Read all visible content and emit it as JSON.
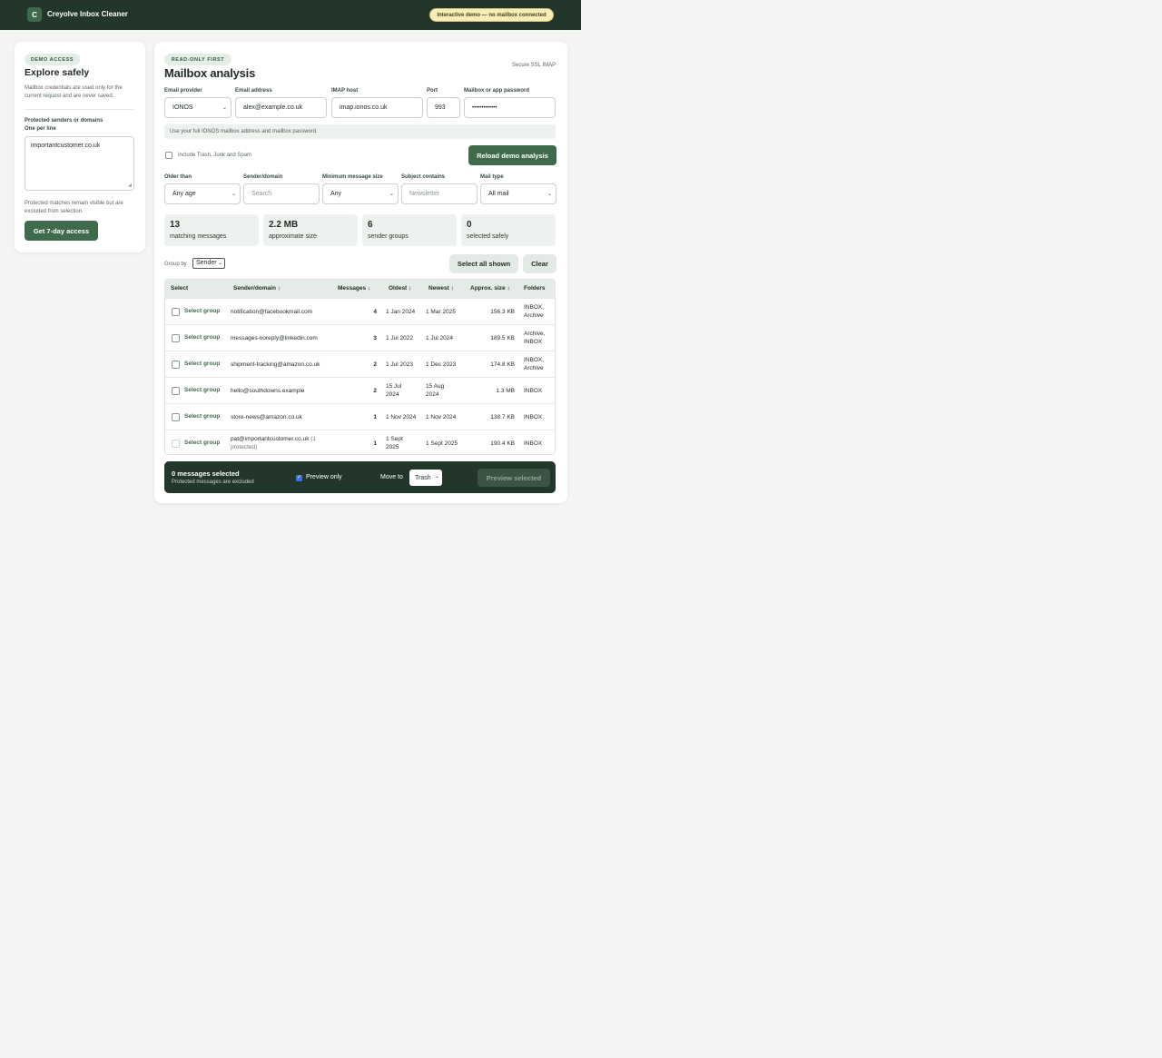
{
  "header": {
    "logo_letter": "C",
    "app_title": "Creyolve Inbox Cleaner",
    "demo_badge": "Interactive demo — no mailbox connected"
  },
  "sidebar": {
    "badge": "DEMO ACCESS",
    "title": "Explore safely",
    "description": "Mailbox credentials are used only for the current request and are never saved.",
    "protected_label": "Protected senders or domains",
    "protected_sublabel": "One per line",
    "protected_value": "importantcustomer.co.uk",
    "protected_note": "Protected matches remain visible but are excluded from selection.",
    "access_button": "Get 7-day access"
  },
  "main": {
    "badge": "READ-ONLY FIRST",
    "title": "Mailbox analysis",
    "ssl_note": "Secure SSL IMAP",
    "connection": {
      "provider_label": "Email provider",
      "provider_value": "IONOS",
      "email_label": "Email address",
      "email_value": "alex@example.co.uk",
      "host_label": "IMAP host",
      "host_value": "imap.ionos.co.uk",
      "port_label": "Port",
      "port_value": "993",
      "password_label": "Mailbox or app password",
      "password_value": "•••••••••••••",
      "hint": "Use your full IONOS mailbox address and mailbox password."
    },
    "include_trash_label": "Include Trash, Junk and Spam",
    "reload_button": "Reload demo analysis",
    "filters": {
      "older_label": "Older than",
      "older_value": "Any age",
      "sender_label": "Sender/domain",
      "sender_placeholder": "Search",
      "size_label": "Minimum message size",
      "size_value": "Any",
      "subject_label": "Subject contains",
      "subject_placeholder": "Newsletter",
      "type_label": "Mail type",
      "type_value": "All mail"
    },
    "stats": [
      {
        "value": "13",
        "caption": "matching messages"
      },
      {
        "value": "2.2 MB",
        "caption": "approximate size"
      },
      {
        "value": "6",
        "caption": "sender groups"
      },
      {
        "value": "0",
        "caption": "selected safely"
      }
    ],
    "group_by_label": "Group by",
    "group_by_value": "Sender",
    "select_all_button": "Select all shown",
    "clear_button": "Clear",
    "table": {
      "headers": {
        "select": "Select",
        "sender": "Sender/domain ↕",
        "messages": "Messages ↓",
        "oldest": "Oldest ↕",
        "newest": "Newest ↕",
        "size": "Approx. size ↕",
        "folders": "Folders"
      },
      "select_group_label": "Select group",
      "rows": [
        {
          "sender": "notification@facebookmail.com",
          "messages": "4",
          "oldest": "1 Jan 2024",
          "newest": "1 Mar 2025",
          "size": "156.3 KB",
          "folders": "INBOX, Archive"
        },
        {
          "sender": "messages-noreply@linkedin.com",
          "messages": "3",
          "oldest": "1 Jul 2022",
          "newest": "1 Jul 2024",
          "size": "189.5 KB",
          "folders": "Archive, INBOX"
        },
        {
          "sender": "shipment-tracking@amazon.co.uk",
          "messages": "2",
          "oldest": "1 Jul 2023",
          "newest": "1 Dec 2023",
          "size": "174.8 KB",
          "folders": "INBOX, Archive"
        },
        {
          "sender": "hello@southdowns.example",
          "messages": "2",
          "oldest": "15 Jul 2024",
          "newest": "15 Aug 2024",
          "size": "1.3 MB",
          "folders": "INBOX"
        },
        {
          "sender": "store-news@amazon.co.uk",
          "messages": "1",
          "oldest": "1 Nov 2024",
          "newest": "1 Nov 2024",
          "size": "138.7 KB",
          "folders": "INBOX"
        },
        {
          "sender": "pat@importantcustomer.co.uk",
          "sender_note": "(1 protected)",
          "messages": "1",
          "oldest": "1 Sept 2025",
          "newest": "1 Sept 2025",
          "size": "190.4 KB",
          "folders": "INBOX"
        }
      ]
    },
    "action_bar": {
      "selected_text": "0 messages selected",
      "selected_sub": "Protected messages are excluded",
      "preview_only_label": "Preview only",
      "move_to_label": "Move to",
      "move_to_value": "Trash",
      "preview_button": "Preview selected"
    }
  },
  "colors": {
    "header_bg": "#22372a",
    "accent": "#3f6a4c",
    "badge_bg": "#f8edb8"
  }
}
